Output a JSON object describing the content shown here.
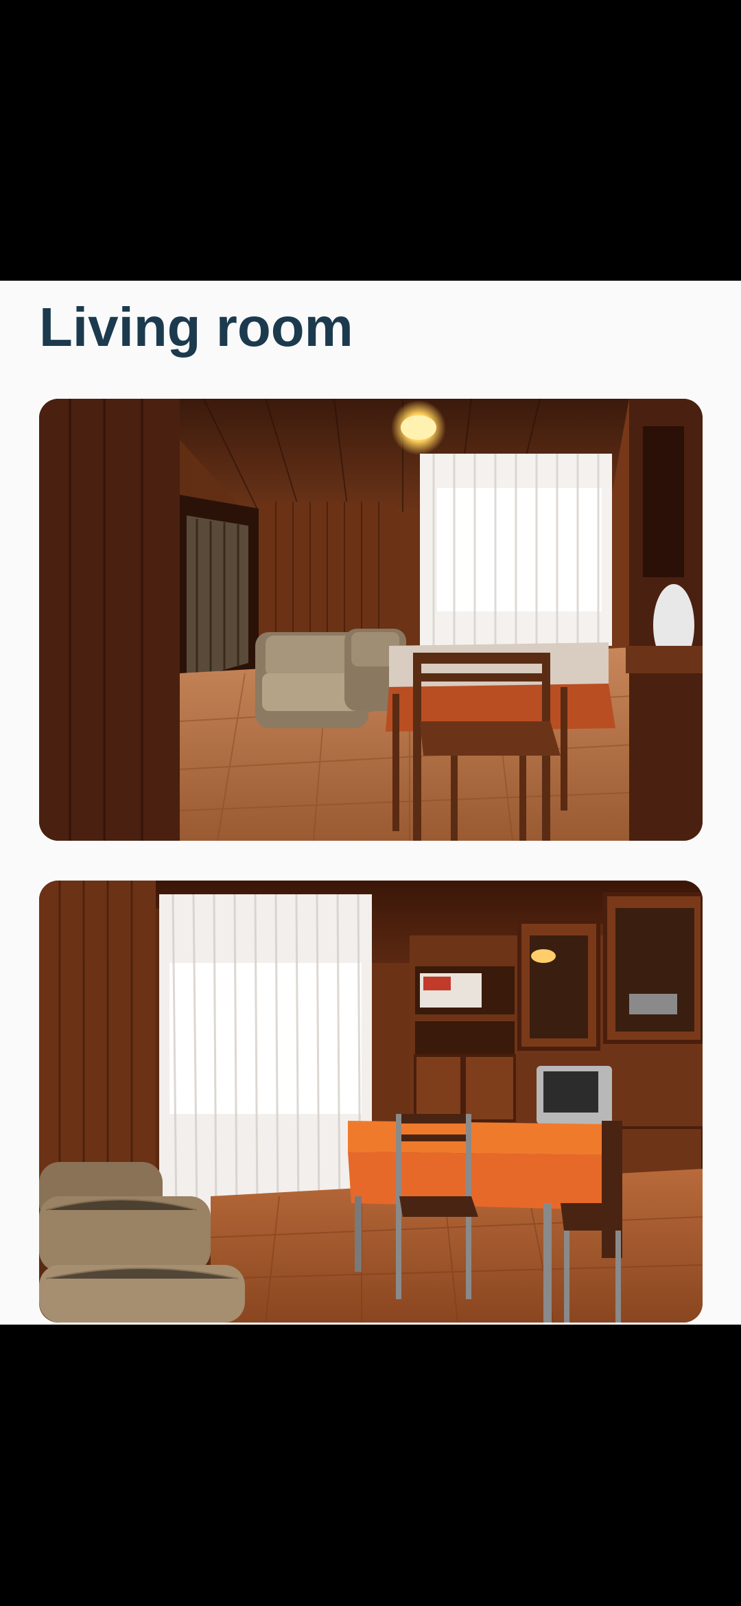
{
  "page": {
    "title": "Living room"
  },
  "gallery": {
    "photos": [
      {
        "label": "photo-1"
      },
      {
        "label": "photo-2"
      }
    ]
  },
  "colors": {
    "title": "#1c3a4e",
    "background": "#fafafa",
    "bars": "#000000"
  }
}
